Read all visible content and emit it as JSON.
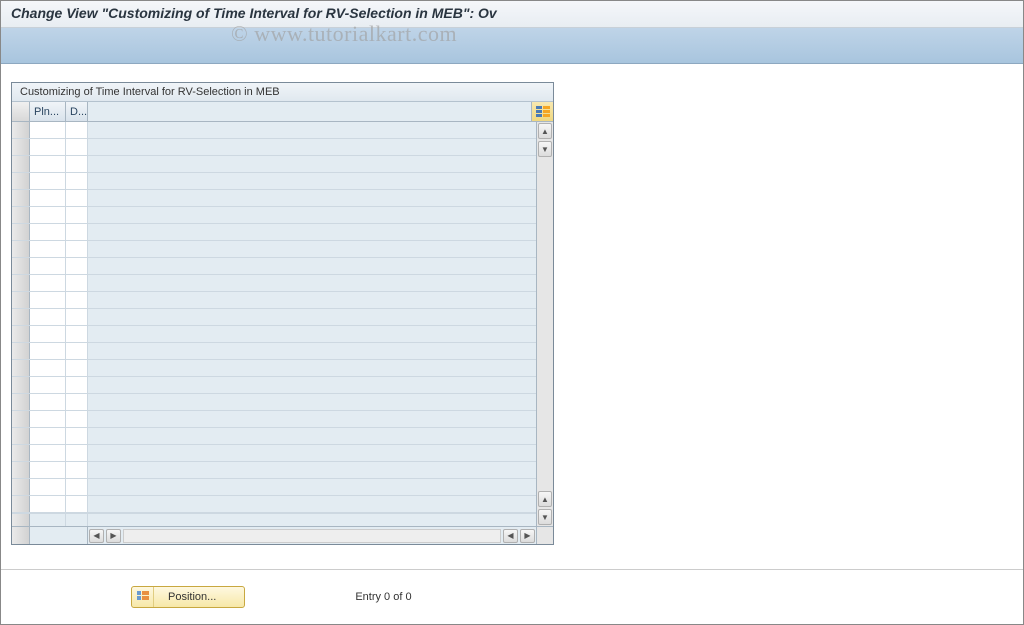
{
  "header": {
    "title": "Change View \"Customizing of Time Interval for RV-Selection in MEB\": Ov"
  },
  "watermark": "© www.tutorialkart.com",
  "grid": {
    "panel_title": "Customizing of Time Interval for RV-Selection in MEB",
    "columns": {
      "pln": "Pln...",
      "d": "D..."
    },
    "row_count": 23
  },
  "footer": {
    "position_button": "Position...",
    "entry_text": "Entry 0 of 0"
  },
  "icons": {
    "configure": "table-configure-icon",
    "position": "position-icon"
  }
}
